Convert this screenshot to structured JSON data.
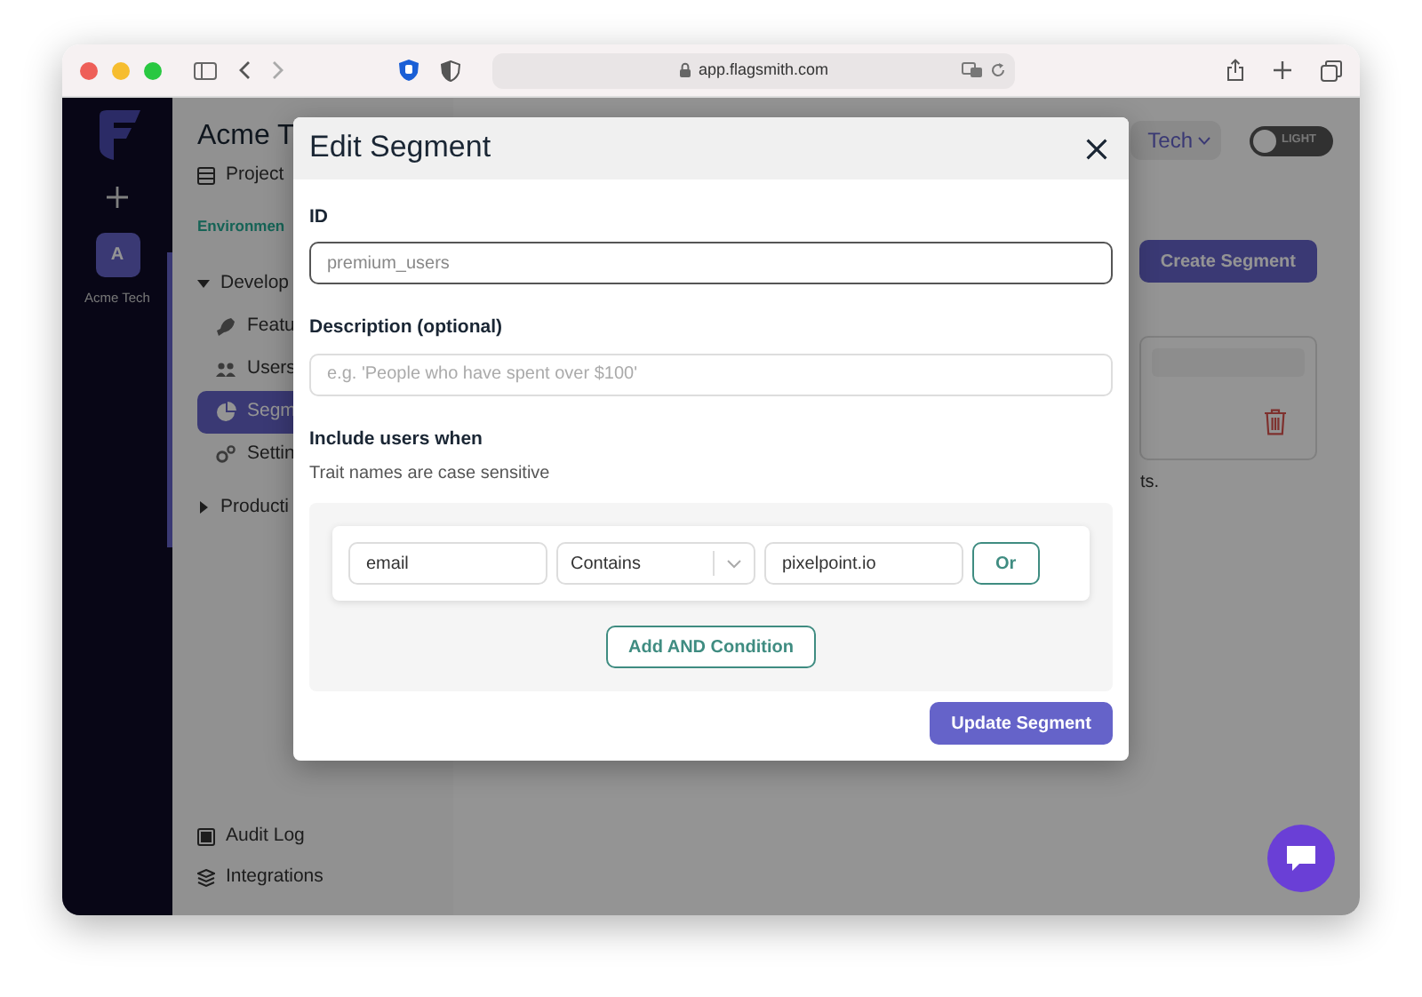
{
  "browser": {
    "url": "app.flagsmith.com"
  },
  "app_nav": {
    "avatar_letter": "A",
    "org_name": "Acme Tech"
  },
  "sidebar": {
    "project_title": "Acme T",
    "project_link": "Project",
    "environments_label": "Environmen",
    "environments": [
      {
        "label": "Develop",
        "expanded": true,
        "children": [
          {
            "label": "Featu",
            "selected": false
          },
          {
            "label": "Users",
            "selected": false
          },
          {
            "label": "Segm",
            "selected": true
          },
          {
            "label": "Settin",
            "selected": false
          }
        ]
      },
      {
        "label": "Producti",
        "expanded": false
      }
    ],
    "footer_links": [
      {
        "label": "Audit Log"
      },
      {
        "label": "Integrations"
      }
    ]
  },
  "header": {
    "org_switch": "Tech",
    "theme_toggle": {
      "label": "LIGHT",
      "on": false
    }
  },
  "main": {
    "create_button": "Create Segment",
    "hint_text": "ts."
  },
  "modal": {
    "title": "Edit Segment",
    "id_field": {
      "label": "ID",
      "value": "premium_users"
    },
    "description_field": {
      "label": "Description (optional)",
      "placeholder": "e.g. 'People who have spent over $100'"
    },
    "rules_title": "Include users when",
    "rules_hint": "Trait names are case sensitive",
    "conditions": [
      {
        "property": "email",
        "operator": "Contains",
        "value": "pixelpoint.io",
        "or_button": "Or"
      }
    ],
    "add_button": "Add AND Condition",
    "submit_button": "Update Segment"
  }
}
